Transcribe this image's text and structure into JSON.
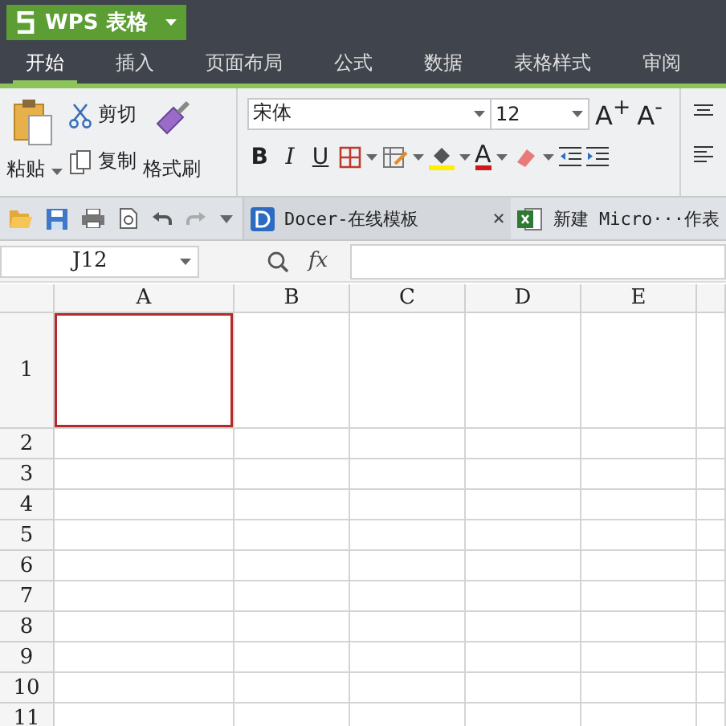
{
  "app_button": {
    "label": "WPS 表格"
  },
  "tabs": [
    {
      "label": "开始",
      "selected": true
    },
    {
      "label": "插入",
      "selected": false
    },
    {
      "label": "页面布局",
      "selected": false
    },
    {
      "label": "公式",
      "selected": false
    },
    {
      "label": "数据",
      "selected": false
    },
    {
      "label": "表格样式",
      "selected": false
    },
    {
      "label": "审阅",
      "selected": false
    }
  ],
  "clipboard": {
    "paste": "粘贴",
    "cut": "剪切",
    "copy": "复制",
    "format_painter": "格式刷"
  },
  "font": {
    "family": "宋体",
    "size": "12",
    "grow": "A$^{+}$",
    "shrink": "A$^{-}$",
    "bold": "B",
    "italic": "I",
    "underline": "U",
    "font_color": "A"
  },
  "doc_tabs": [
    {
      "title": "Docer-在线模板",
      "close": "×",
      "kind": "docer"
    },
    {
      "title": "新建 Micro···作表",
      "kind": "sheet"
    }
  ],
  "formula_bar": {
    "name_box": "J12",
    "fx": "fx"
  },
  "grid": {
    "columns": [
      "A",
      "B",
      "C",
      "D",
      "E"
    ],
    "rows": [
      {
        "label": "1",
        "cells": [
          {
            "selected": true
          },
          {
            "selected": false
          },
          {
            "selected": false
          },
          {
            "selected": false
          },
          {
            "selected": false
          }
        ]
      },
      {
        "label": "2",
        "cells": [
          {
            "selected": false
          },
          {
            "selected": false
          },
          {
            "selected": false
          },
          {
            "selected": false
          },
          {
            "selected": false
          }
        ]
      },
      {
        "label": "3",
        "cells": [
          {
            "selected": false
          },
          {
            "selected": false
          },
          {
            "selected": false
          },
          {
            "selected": false
          },
          {
            "selected": false
          }
        ]
      },
      {
        "label": "4",
        "cells": [
          {
            "selected": false
          },
          {
            "selected": false
          },
          {
            "selected": false
          },
          {
            "selected": false
          },
          {
            "selected": false
          }
        ]
      },
      {
        "label": "5",
        "cells": [
          {
            "selected": false
          },
          {
            "selected": false
          },
          {
            "selected": false
          },
          {
            "selected": false
          },
          {
            "selected": false
          }
        ]
      },
      {
        "label": "6",
        "cells": [
          {
            "selected": false
          },
          {
            "selected": false
          },
          {
            "selected": false
          },
          {
            "selected": false
          },
          {
            "selected": false
          }
        ]
      },
      {
        "label": "7",
        "cells": [
          {
            "selected": false
          },
          {
            "selected": false
          },
          {
            "selected": false
          },
          {
            "selected": false
          },
          {
            "selected": false
          }
        ]
      },
      {
        "label": "8",
        "cells": [
          {
            "selected": false
          },
          {
            "selected": false
          },
          {
            "selected": false
          },
          {
            "selected": false
          },
          {
            "selected": false
          }
        ]
      },
      {
        "label": "9",
        "cells": [
          {
            "selected": false
          },
          {
            "selected": false
          },
          {
            "selected": false
          },
          {
            "selected": false
          },
          {
            "selected": false
          }
        ]
      },
      {
        "label": "10",
        "cells": [
          {
            "selected": false
          },
          {
            "selected": false
          },
          {
            "selected": false
          },
          {
            "selected": false
          },
          {
            "selected": false
          }
        ]
      },
      {
        "label": "11",
        "cells": [
          {
            "selected": false
          },
          {
            "selected": false
          },
          {
            "selected": false
          },
          {
            "selected": false
          },
          {
            "selected": false
          }
        ]
      }
    ]
  }
}
